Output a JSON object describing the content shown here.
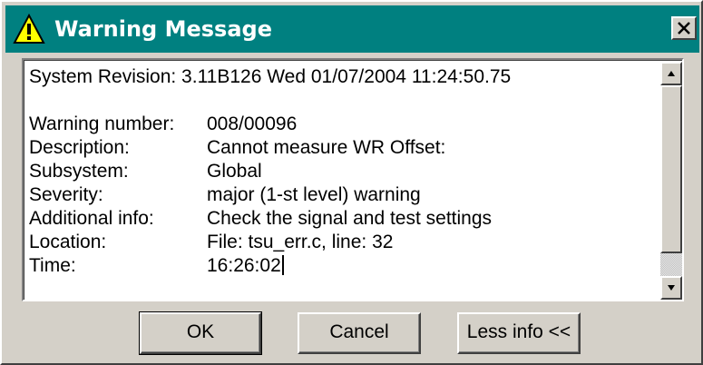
{
  "window": {
    "title": "Warning Message",
    "title_icon": "warning-icon",
    "close_icon": "close-icon",
    "titlebar_color": "#008080",
    "face_color": "#d4d0c8"
  },
  "message": {
    "revision": "System Revision: 3.11B126 Wed 01/07/2004 11:24:50.75",
    "fields": [
      {
        "label": "Warning number:",
        "value": "008/00096"
      },
      {
        "label": "Description:",
        "value": "Cannot measure WR Offset:"
      },
      {
        "label": "Subsystem:",
        "value": "Global"
      },
      {
        "label": "Severity:",
        "value": "major (1-st level) warning"
      },
      {
        "label": "Additional info:",
        "value": "Check the signal and test settings"
      },
      {
        "label": "Location:",
        "value": "File: tsu_err.c, line: 32"
      },
      {
        "label": "Time:",
        "value": "16:26:02"
      }
    ]
  },
  "buttons": {
    "ok": "OK",
    "cancel": "Cancel",
    "less_info": "Less info <<"
  }
}
